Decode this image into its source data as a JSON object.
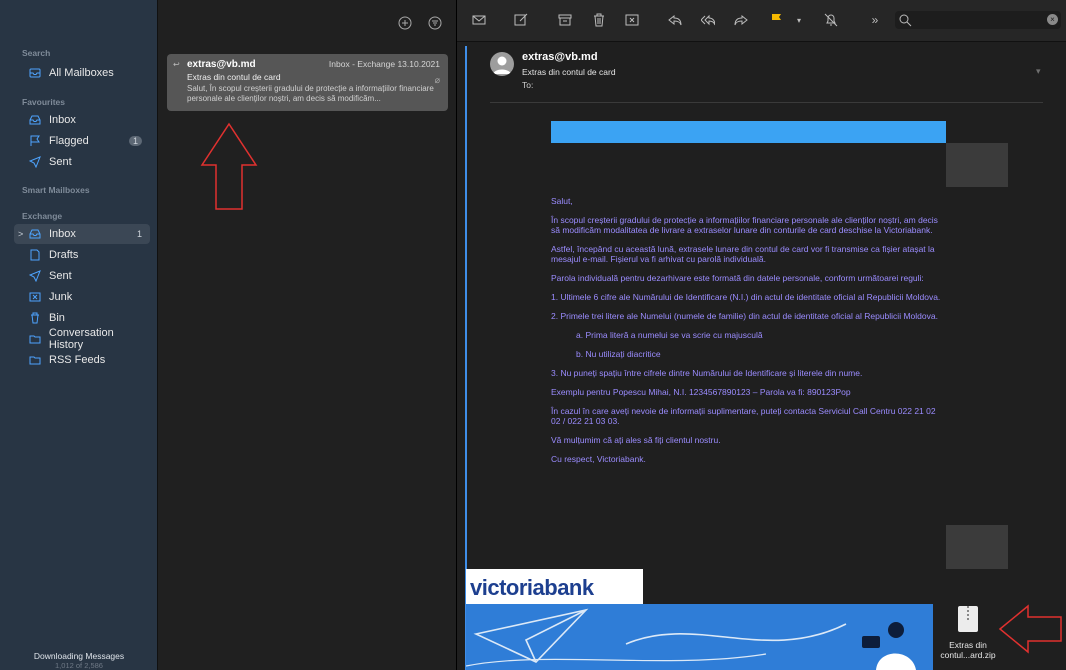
{
  "sidebar": {
    "sections": {
      "search": "Search",
      "favourites": "Favourites",
      "smart": "Smart Mailboxes",
      "exchange": "Exchange"
    },
    "search_items": [
      {
        "label": "All Mailboxes",
        "icon": "mailboxes-icon"
      }
    ],
    "favourite_items": [
      {
        "label": "Inbox",
        "icon": "inbox-icon"
      },
      {
        "label": "Flagged",
        "icon": "flag-icon",
        "badge": "1"
      },
      {
        "label": "Sent",
        "icon": "sent-icon"
      }
    ],
    "exchange_items": [
      {
        "label": "Inbox",
        "icon": "inbox-icon",
        "badge": "1",
        "selected": true
      },
      {
        "label": "Drafts",
        "icon": "drafts-icon"
      },
      {
        "label": "Sent",
        "icon": "sent-icon"
      },
      {
        "label": "Junk",
        "icon": "junk-icon"
      },
      {
        "label": "Bin",
        "icon": "bin-icon"
      },
      {
        "label": "Conversation History",
        "icon": "folder-icon"
      },
      {
        "label": "RSS Feeds",
        "icon": "folder-icon"
      }
    ],
    "status": {
      "line1": "Downloading Messages",
      "line2": "1,012 of 2,586"
    }
  },
  "message_list": {
    "selected_message": {
      "from": "extras@vb.md",
      "mailbox": "Inbox - Exchange",
      "date": "13.10.2021",
      "subject": "Extras din contul de card",
      "preview": "Salut, În scopul creșterii gradului de protecție a informațiilor financiare personale ale clienților noștri, am decis să modificăm..."
    }
  },
  "reader": {
    "from": "extras@vb.md",
    "subject": "Extras din contul de card",
    "to_label": "To:",
    "body": {
      "greeting": "Salut,",
      "p1": "În scopul creșterii gradului de protecție a informațiilor financiare personale ale clienților noștri, am decis să modificăm modalitatea de livrare a extraselor lunare din conturile de card deschise la Victoriabank.",
      "p2": "Astfel, începând cu această lună, extrasele lunare din contul de card vor fi transmise ca fișier atașat la mesajul e-mail. Fișierul va fi arhivat cu parolă individuală.",
      "p3": "Parola individuală pentru dezarhivare este formată din datele personale, conform următoarei reguli:",
      "r1": "1. Ultimele 6 cifre ale Numărului de Identificare (N.I.) din actul de identitate oficial al Republicii Moldova.",
      "r2": "2. Primele trei litere ale Numelui (numele de familie) din actul de identitate oficial al Republicii Moldova.",
      "r2a": "a. Prima literă a numelui se va scrie cu majusculă",
      "r2b": "b. Nu utilizați diacritice",
      "r3": "3. Nu puneți spațiu între cifrele dintre Numărului de Identificare și literele din nume.",
      "example": "Exemplu pentru Popescu Mihai, N.I. 1234567890123 – Parola va fi: 890123Pop",
      "contact": "În cazul în care aveți nevoie de informații suplimentare, puteți contacta Serviciul Call Centru 022 21 02 02 / 022 21 03 03.",
      "thanks": "Vă mulțumim că ați ales să fiți clientul nostru.",
      "signoff": "Cu respect, Victoriabank."
    },
    "logo_text": "victoriabank",
    "attachment": {
      "name": "Extras din contul...ard.zip",
      "icon": "zip-file-icon"
    }
  },
  "colors": {
    "sidebar_bg": "#283544",
    "accent_blue": "#3ba3f3",
    "body_text": "#9b8cff",
    "annotation_red": "#e0312f",
    "flag": "#f5b800"
  }
}
